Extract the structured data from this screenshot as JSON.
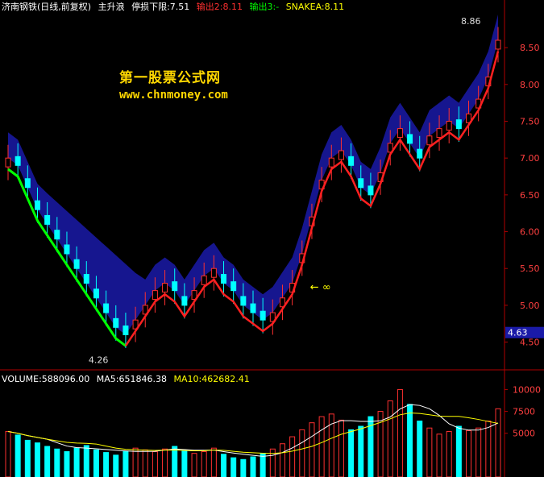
{
  "header": {
    "title": "济南钢铁(日线,前复权)",
    "indicator": "主升浪",
    "stop_loss": "停损下限:7.51",
    "out2": "输出2:8.11",
    "out3": "输出3:-",
    "snakea": "SNAKEA:8.11"
  },
  "volume_header": {
    "volume": "VOLUME:588096.00",
    "ma5": "MA5:651846.38",
    "ma10": "MA10:462682.41"
  },
  "watermark": {
    "title": "第一股票公式网",
    "url": "www.chnmoney.com"
  },
  "colors": {
    "up": "#ff3030",
    "down": "#00ffff",
    "green_line": "#00ff00",
    "red_line": "#ff2020",
    "fill": "#1a1aa8",
    "axis": "#b00000",
    "vol_ma5": "#ffffff",
    "vol_ma10": "#ffff00"
  },
  "chart_data": [
    {
      "type": "candlestick",
      "y_axis_ticks": [
        8.5,
        8.0,
        7.5,
        7.0,
        6.5,
        6.0,
        5.5,
        5.0,
        4.5
      ],
      "ylim": [
        4.2,
        8.95
      ],
      "annotations": {
        "high": "8.86",
        "low": "4.26",
        "current": "4.63",
        "arrow_label": "∞"
      },
      "series": [
        {
          "name": "main_price",
          "values": [
            7.0,
            6.9,
            6.6,
            6.3,
            6.1,
            5.9,
            5.7,
            5.5,
            5.3,
            5.1,
            4.9,
            4.7,
            4.6,
            4.8,
            5.0,
            5.2,
            5.3,
            5.2,
            5.0,
            5.2,
            5.4,
            5.5,
            5.3,
            5.2,
            5.0,
            4.9,
            4.8,
            4.9,
            5.1,
            5.3,
            5.7,
            6.2,
            6.7,
            7.0,
            7.1,
            6.9,
            6.6,
            6.5,
            6.8,
            7.2,
            7.4,
            7.2,
            7.0,
            7.3,
            7.4,
            7.5,
            7.4,
            7.6,
            7.8,
            8.1,
            8.6
          ]
        }
      ]
    },
    {
      "type": "bar",
      "title": "VOLUME",
      "y_axis_ticks": [
        10000,
        7500,
        5000
      ],
      "ylim": [
        0,
        10500
      ],
      "series": [
        {
          "name": "volume",
          "values": [
            5200,
            4800,
            4200,
            3900,
            3500,
            3200,
            2900,
            3300,
            3600,
            3100,
            2800,
            2500,
            2900,
            3300,
            3100,
            2900,
            3200,
            3500,
            3000,
            2700,
            2900,
            3300,
            2600,
            2200,
            2000,
            2300,
            2700,
            3200,
            3800,
            4600,
            5400,
            6200,
            6900,
            7200,
            6500,
            5400,
            5800,
            6900,
            7500,
            8700,
            10000,
            8300,
            6400,
            5600,
            4900,
            5200,
            5800,
            5300,
            5600,
            6400,
            7800
          ]
        }
      ]
    }
  ]
}
